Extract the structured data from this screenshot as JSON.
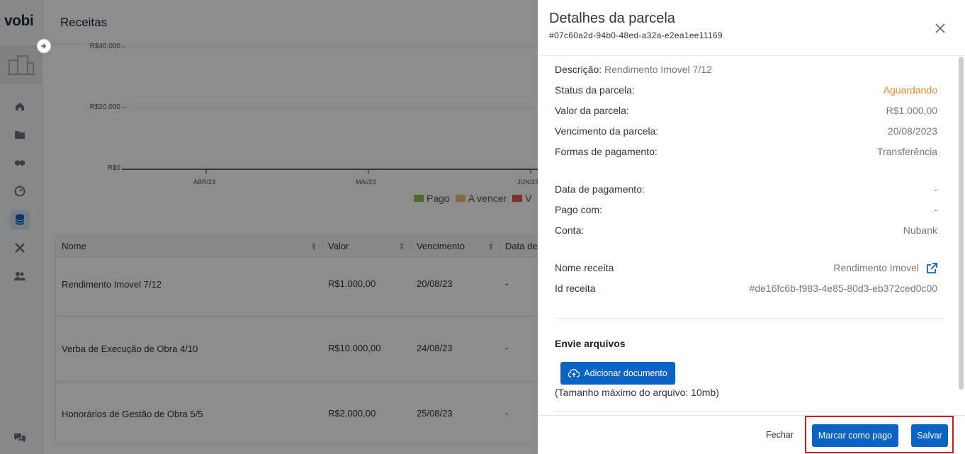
{
  "app": {
    "logo": "vobi",
    "page_title": "Receitas"
  },
  "chart_data": {
    "type": "bar",
    "categories": [
      "ABR/23",
      "MAI/23",
      "JUN/23"
    ],
    "y_ticks": [
      "R$40.000",
      "R$20.000",
      "R$0"
    ],
    "legend": [
      "Pago",
      "A vencer",
      "V"
    ]
  },
  "colors": {
    "pago": "#8bc34a",
    "a_vencer": "#e8c27a",
    "vencido": "#e05a4a",
    "accent": "#0b63c5",
    "status_orange": "#f08a24",
    "highlight_red": "#e01414"
  },
  "table": {
    "headers": [
      "Nome",
      "Valor",
      "Vencimento",
      "Data de"
    ],
    "rows": [
      {
        "nome": "Rendimento Imovel 7/12",
        "valor": "R$1.000,00",
        "vencimento": "20/08/23",
        "data": "-"
      },
      {
        "nome": "Verba de Execução de Obra 4/10",
        "valor": "R$10.000,00",
        "vencimento": "24/08/23",
        "data": "-"
      },
      {
        "nome": "Honorários de Gestão de Obra 5/5",
        "valor": "R$2.000,00",
        "vencimento": "25/08/23",
        "data": "-"
      }
    ]
  },
  "drawer": {
    "title": "Detalhes da parcela",
    "subtitle": "#07c60a2d-94b0-48ed-a32a-e2ea1ee11169",
    "descricao_label": "Descrição:",
    "descricao_value": "Rendimento Imovel 7/12",
    "details": [
      {
        "label": "Status da parcela:",
        "value": "Aguardando"
      },
      {
        "label": "Valor da parcela:",
        "value": "R$1.000,00"
      },
      {
        "label": "Vencimento da parcela:",
        "value": "20/08/2023"
      },
      {
        "label": "Formas de pagamento:",
        "value": "Transferência"
      }
    ],
    "payment": [
      {
        "label": "Data de pagamento:",
        "value": "-"
      },
      {
        "label": "Pago com:",
        "value": "-"
      },
      {
        "label": "Conta:",
        "value": "Nubank"
      }
    ],
    "receita": [
      {
        "label": "Nome receita",
        "value": "Rendimento Imovel"
      },
      {
        "label": "Id receita",
        "value": "#de16fc6b-f983-4e85-80d3-eb372ced0c00"
      }
    ],
    "upload": {
      "section_title": "Envie arquivos",
      "button_label": "Adicionar documento",
      "hint": "(Tamanho máximo do arquivo: 10mb)"
    },
    "footer": {
      "close_label": "Fechar",
      "mark_paid_label": "Marcar como pago",
      "save_label": "Salvar"
    }
  }
}
